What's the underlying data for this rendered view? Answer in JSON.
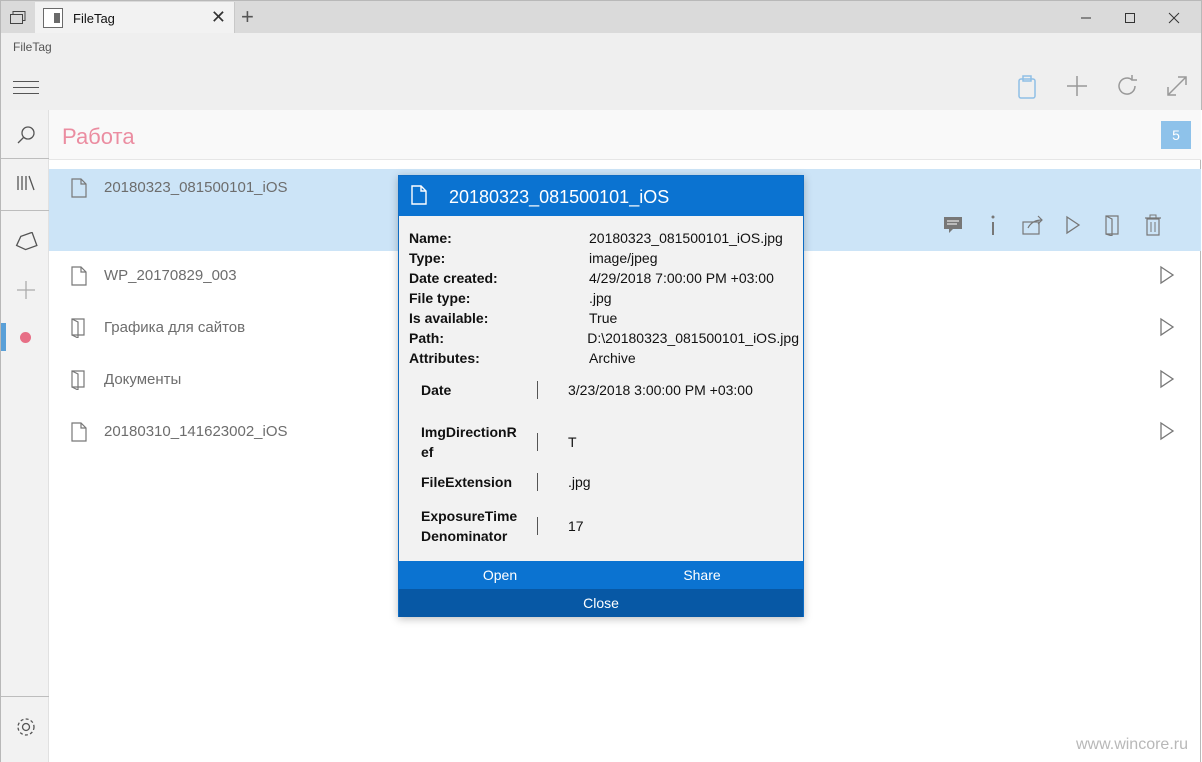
{
  "window": {
    "tab_title": "FileTag",
    "new_tab_glyph": "+",
    "close_tab_glyph": "✕"
  },
  "app": {
    "title": "FileTag",
    "header_icons": [
      "clipboard-icon",
      "add-icon",
      "refresh-icon",
      "expand-icon"
    ]
  },
  "rail": {
    "items": [
      "search-icon",
      "library-icon",
      "tag-icon",
      "add-icon",
      "color-dot-icon",
      "settings-icon"
    ],
    "accent_dot_color": "#e76f86"
  },
  "group": {
    "title": "Работа",
    "count": "5"
  },
  "files": [
    {
      "name": "20180323_081500101_iOS",
      "type": "file",
      "selected": true
    },
    {
      "name": "WP_20170829_003",
      "type": "file"
    },
    {
      "name": "Графика для сайтов",
      "type": "folder"
    },
    {
      "name": "Документы",
      "type": "folder"
    },
    {
      "name": "20180310_141623002_iOS",
      "type": "file"
    }
  ],
  "dialog": {
    "title": "20180323_081500101_iOS",
    "properties": [
      {
        "key": "Name:",
        "value": "20180323_081500101_iOS.jpg"
      },
      {
        "key": "Type:",
        "value": "image/jpeg"
      },
      {
        "key": "Date created:",
        "value": "4/29/2018 7:00:00 PM +03:00"
      },
      {
        "key": "File type:",
        "value": ".jpg"
      },
      {
        "key": "Is available:",
        "value": "True"
      },
      {
        "key": "Path:",
        "value": "D:\\20180323_081500101_iOS.jpg"
      },
      {
        "key": "Attributes:",
        "value": "Archive"
      }
    ],
    "metadata": [
      {
        "key": "Date",
        "value": "3/23/2018 3:00:00 PM +03:00"
      },
      {
        "key": "ImgDirectionRef",
        "value": "T"
      },
      {
        "key": "FileExtension",
        "value": ".jpg"
      },
      {
        "key": "ExposureTimeDenominator",
        "value": "17"
      }
    ],
    "open_label": "Open",
    "share_label": "Share",
    "close_label": "Close"
  },
  "watermark": "www.wincore.ru",
  "colors": {
    "accent": "#0b73d1",
    "selected_row": "#cce4f7",
    "group_title": "#eb8da1",
    "badge": "#8ec2ea"
  }
}
